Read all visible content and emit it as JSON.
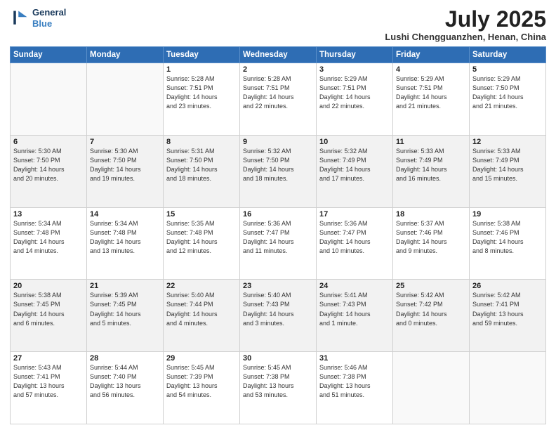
{
  "header": {
    "logo_line1": "General",
    "logo_line2": "Blue",
    "month_title": "July 2025",
    "location": "Lushi Chengguanzhen, Henan, China"
  },
  "days_of_week": [
    "Sunday",
    "Monday",
    "Tuesday",
    "Wednesday",
    "Thursday",
    "Friday",
    "Saturday"
  ],
  "weeks": [
    [
      {
        "day": "",
        "detail": ""
      },
      {
        "day": "",
        "detail": ""
      },
      {
        "day": "1",
        "detail": "Sunrise: 5:28 AM\nSunset: 7:51 PM\nDaylight: 14 hours\nand 23 minutes."
      },
      {
        "day": "2",
        "detail": "Sunrise: 5:28 AM\nSunset: 7:51 PM\nDaylight: 14 hours\nand 22 minutes."
      },
      {
        "day": "3",
        "detail": "Sunrise: 5:29 AM\nSunset: 7:51 PM\nDaylight: 14 hours\nand 22 minutes."
      },
      {
        "day": "4",
        "detail": "Sunrise: 5:29 AM\nSunset: 7:51 PM\nDaylight: 14 hours\nand 21 minutes."
      },
      {
        "day": "5",
        "detail": "Sunrise: 5:29 AM\nSunset: 7:50 PM\nDaylight: 14 hours\nand 21 minutes."
      }
    ],
    [
      {
        "day": "6",
        "detail": "Sunrise: 5:30 AM\nSunset: 7:50 PM\nDaylight: 14 hours\nand 20 minutes."
      },
      {
        "day": "7",
        "detail": "Sunrise: 5:30 AM\nSunset: 7:50 PM\nDaylight: 14 hours\nand 19 minutes."
      },
      {
        "day": "8",
        "detail": "Sunrise: 5:31 AM\nSunset: 7:50 PM\nDaylight: 14 hours\nand 18 minutes."
      },
      {
        "day": "9",
        "detail": "Sunrise: 5:32 AM\nSunset: 7:50 PM\nDaylight: 14 hours\nand 18 minutes."
      },
      {
        "day": "10",
        "detail": "Sunrise: 5:32 AM\nSunset: 7:49 PM\nDaylight: 14 hours\nand 17 minutes."
      },
      {
        "day": "11",
        "detail": "Sunrise: 5:33 AM\nSunset: 7:49 PM\nDaylight: 14 hours\nand 16 minutes."
      },
      {
        "day": "12",
        "detail": "Sunrise: 5:33 AM\nSunset: 7:49 PM\nDaylight: 14 hours\nand 15 minutes."
      }
    ],
    [
      {
        "day": "13",
        "detail": "Sunrise: 5:34 AM\nSunset: 7:48 PM\nDaylight: 14 hours\nand 14 minutes."
      },
      {
        "day": "14",
        "detail": "Sunrise: 5:34 AM\nSunset: 7:48 PM\nDaylight: 14 hours\nand 13 minutes."
      },
      {
        "day": "15",
        "detail": "Sunrise: 5:35 AM\nSunset: 7:48 PM\nDaylight: 14 hours\nand 12 minutes."
      },
      {
        "day": "16",
        "detail": "Sunrise: 5:36 AM\nSunset: 7:47 PM\nDaylight: 14 hours\nand 11 minutes."
      },
      {
        "day": "17",
        "detail": "Sunrise: 5:36 AM\nSunset: 7:47 PM\nDaylight: 14 hours\nand 10 minutes."
      },
      {
        "day": "18",
        "detail": "Sunrise: 5:37 AM\nSunset: 7:46 PM\nDaylight: 14 hours\nand 9 minutes."
      },
      {
        "day": "19",
        "detail": "Sunrise: 5:38 AM\nSunset: 7:46 PM\nDaylight: 14 hours\nand 8 minutes."
      }
    ],
    [
      {
        "day": "20",
        "detail": "Sunrise: 5:38 AM\nSunset: 7:45 PM\nDaylight: 14 hours\nand 6 minutes."
      },
      {
        "day": "21",
        "detail": "Sunrise: 5:39 AM\nSunset: 7:45 PM\nDaylight: 14 hours\nand 5 minutes."
      },
      {
        "day": "22",
        "detail": "Sunrise: 5:40 AM\nSunset: 7:44 PM\nDaylight: 14 hours\nand 4 minutes."
      },
      {
        "day": "23",
        "detail": "Sunrise: 5:40 AM\nSunset: 7:43 PM\nDaylight: 14 hours\nand 3 minutes."
      },
      {
        "day": "24",
        "detail": "Sunrise: 5:41 AM\nSunset: 7:43 PM\nDaylight: 14 hours\nand 1 minute."
      },
      {
        "day": "25",
        "detail": "Sunrise: 5:42 AM\nSunset: 7:42 PM\nDaylight: 14 hours\nand 0 minutes."
      },
      {
        "day": "26",
        "detail": "Sunrise: 5:42 AM\nSunset: 7:41 PM\nDaylight: 13 hours\nand 59 minutes."
      }
    ],
    [
      {
        "day": "27",
        "detail": "Sunrise: 5:43 AM\nSunset: 7:41 PM\nDaylight: 13 hours\nand 57 minutes."
      },
      {
        "day": "28",
        "detail": "Sunrise: 5:44 AM\nSunset: 7:40 PM\nDaylight: 13 hours\nand 56 minutes."
      },
      {
        "day": "29",
        "detail": "Sunrise: 5:45 AM\nSunset: 7:39 PM\nDaylight: 13 hours\nand 54 minutes."
      },
      {
        "day": "30",
        "detail": "Sunrise: 5:45 AM\nSunset: 7:38 PM\nDaylight: 13 hours\nand 53 minutes."
      },
      {
        "day": "31",
        "detail": "Sunrise: 5:46 AM\nSunset: 7:38 PM\nDaylight: 13 hours\nand 51 minutes."
      },
      {
        "day": "",
        "detail": ""
      },
      {
        "day": "",
        "detail": ""
      }
    ]
  ]
}
